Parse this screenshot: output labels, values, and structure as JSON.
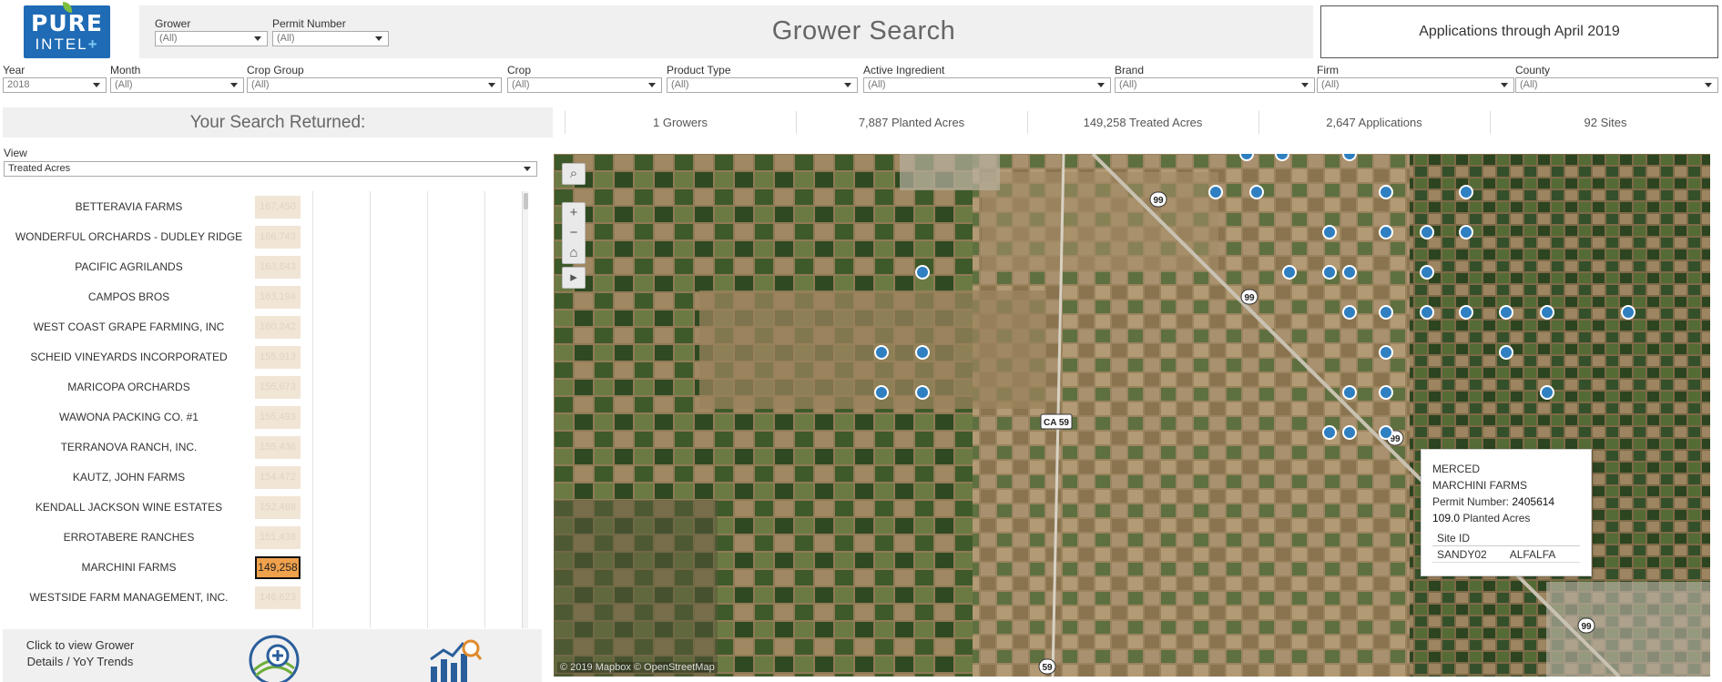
{
  "logo": {
    "line1": "PURE",
    "line2": "INTEL",
    "plus": "+"
  },
  "header": {
    "grower_label": "Grower",
    "grower_value": "(All)",
    "permit_label": "Permit Number",
    "permit_value": "(All)",
    "title": "Grower Search",
    "applications_note": "Applications through April 2019"
  },
  "filters": [
    {
      "label": "Year",
      "value": "2018"
    },
    {
      "label": "Month",
      "value": "(All)"
    },
    {
      "label": "Crop Group",
      "value": "(All)"
    },
    {
      "label": "Crop",
      "value": "(All)"
    },
    {
      "label": "Product Type",
      "value": "(All)"
    },
    {
      "label": "Active Ingredient",
      "value": "(All)"
    },
    {
      "label": "Brand",
      "value": "(All)"
    },
    {
      "label": "Firm",
      "value": "(All)"
    },
    {
      "label": "County",
      "value": "(All)"
    }
  ],
  "summary": {
    "heading": "Your Search Returned:",
    "stats": [
      "1 Growers",
      "7,887 Planted Acres",
      "149,258 Treated Acres",
      "2,647 Applications",
      "92 Sites"
    ]
  },
  "view": {
    "label": "View",
    "value": "Treated Acres"
  },
  "growers": [
    {
      "name": "BETTERAVIA FARMS",
      "value": "167,450",
      "selected": false
    },
    {
      "name": "WONDERFUL ORCHARDS - DUDLEY RIDGE",
      "value": "166,743",
      "selected": false
    },
    {
      "name": "PACIFIC AGRILANDS",
      "value": "163,843",
      "selected": false
    },
    {
      "name": "CAMPOS BROS",
      "value": "163,194",
      "selected": false
    },
    {
      "name": "WEST COAST GRAPE FARMING, INC",
      "value": "160,242",
      "selected": false
    },
    {
      "name": "SCHEID VINEYARDS INCORPORATED",
      "value": "155,913",
      "selected": false
    },
    {
      "name": "MARICOPA ORCHARDS",
      "value": "155,673",
      "selected": false
    },
    {
      "name": "WAWONA PACKING CO. #1",
      "value": "155,493",
      "selected": false
    },
    {
      "name": "TERRANOVA RANCH, INC.",
      "value": "155,436",
      "selected": false
    },
    {
      "name": "KAUTZ, JOHN FARMS",
      "value": "154,472",
      "selected": false
    },
    {
      "name": "KENDALL JACKSON WINE ESTATES",
      "value": "152,488",
      "selected": false
    },
    {
      "name": "ERROTABERE RANCHES",
      "value": "151,438",
      "selected": false
    },
    {
      "name": "MARCHINI FARMS",
      "value": "149,258",
      "selected": true
    },
    {
      "name": "WESTSIDE FARM MANAGEMENT, INC.",
      "value": "146,623",
      "selected": false
    }
  ],
  "bottom": {
    "details_text": "Click to view Grower Details / YoY Trends"
  },
  "map": {
    "controls": {
      "search": "⌕",
      "zoom_in": "+",
      "zoom_out": "−",
      "home": "⌂",
      "play": "▸"
    },
    "copyright": "© 2019 Mapbox © OpenStreetMap",
    "road_labels": [
      "99",
      "99",
      "CA 59",
      "99",
      "99",
      "59"
    ],
    "tooltip": {
      "county": "MERCED",
      "grower": "MARCHINI FARMS",
      "permit_label": "Permit Number:",
      "permit_value": "2405614",
      "planted_value": "109.0",
      "planted_label": "Planted Acres",
      "site_header": "Site ID",
      "site_id": "SANDY02",
      "crop": "ALFALFA"
    },
    "colors": {
      "marker": "#2f7fc1",
      "marker_border": "#ffffff"
    }
  }
}
